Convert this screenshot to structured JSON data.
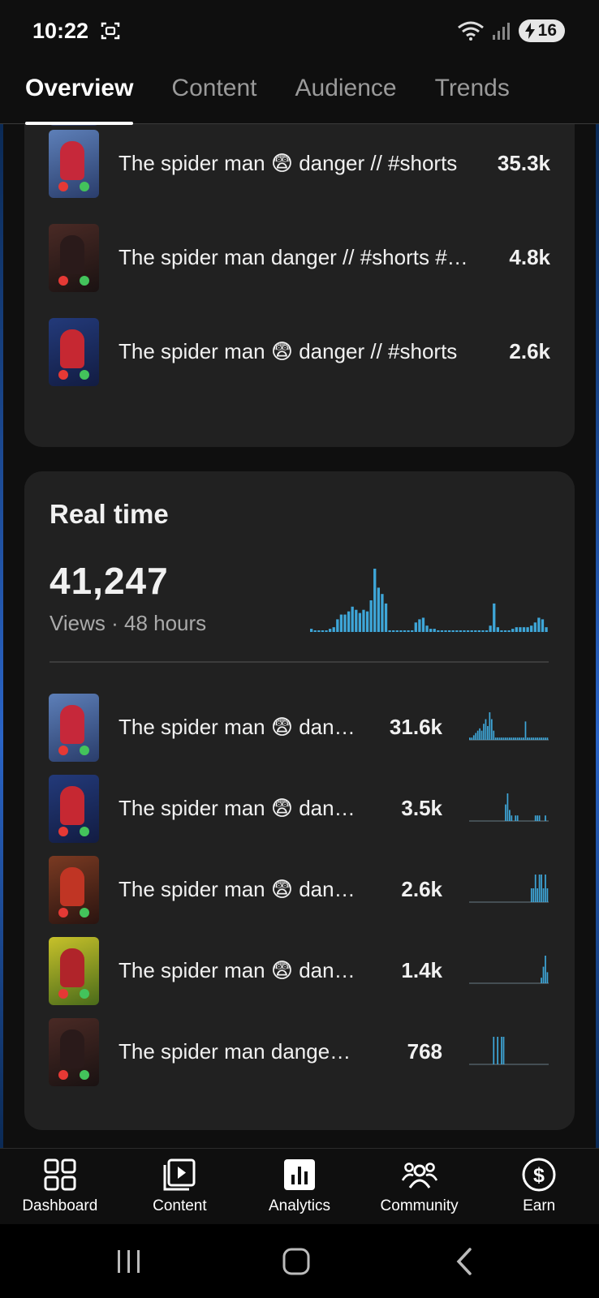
{
  "status_bar": {
    "time": "10:22",
    "battery": "16"
  },
  "tabs": [
    {
      "label": "Overview",
      "active": true
    },
    {
      "label": "Content",
      "active": false
    },
    {
      "label": "Audience",
      "active": false
    },
    {
      "label": "Trends",
      "active": false
    }
  ],
  "top_content_list": [
    {
      "title": "The spider man 😨 danger // #shorts",
      "value": "35.3k",
      "thumb": "blue"
    },
    {
      "title": "The spider man danger // #shorts #shorts",
      "value": "4.8k",
      "thumb": "dark"
    },
    {
      "title": "The spider man 😨 danger // #shorts",
      "value": "2.6k",
      "thumb": "navy"
    }
  ],
  "realtime": {
    "title": "Real time",
    "views": "41,247",
    "subtitle": "Views · 48 hours",
    "chart_data": {
      "type": "bar",
      "values": [
        2,
        1,
        1,
        1,
        1,
        2,
        3,
        8,
        11,
        11,
        13,
        16,
        14,
        12,
        14,
        13,
        20,
        40,
        28,
        24,
        18,
        1,
        1,
        1,
        1,
        1,
        1,
        1,
        6,
        8,
        9,
        4,
        2,
        2,
        1,
        1,
        1,
        1,
        1,
        1,
        1,
        1,
        1,
        1,
        1,
        1,
        1,
        1,
        4,
        18,
        3,
        1,
        1,
        1,
        2,
        3,
        3,
        3,
        3,
        4,
        6,
        9,
        8,
        3
      ]
    },
    "items": [
      {
        "title": "The spider man 😨 danger",
        "value": "31.6k",
        "thumb": "blue",
        "spark": [
          1,
          1,
          2,
          3,
          4,
          5,
          4,
          7,
          9,
          6,
          12,
          9,
          4,
          1,
          1,
          1,
          1,
          1,
          1,
          1,
          1,
          1,
          1,
          1,
          1,
          1,
          1,
          1,
          8,
          1,
          1,
          1,
          1,
          1,
          1,
          1,
          1,
          1,
          1,
          1
        ]
      },
      {
        "title": "The spider man 😨 danger",
        "value": "3.5k",
        "thumb": "navy",
        "spark": [
          0,
          0,
          0,
          0,
          0,
          0,
          0,
          0,
          0,
          0,
          0,
          0,
          0,
          0,
          0,
          0,
          0,
          0,
          3,
          5,
          2,
          1,
          0,
          1,
          1,
          0,
          0,
          0,
          0,
          0,
          0,
          0,
          0,
          1,
          1,
          1,
          0,
          0,
          1,
          0
        ]
      },
      {
        "title": "The spider man 😨 danger",
        "value": "2.6k",
        "thumb": "red",
        "spark": [
          0,
          0,
          0,
          0,
          0,
          0,
          0,
          0,
          0,
          0,
          0,
          0,
          0,
          0,
          0,
          0,
          0,
          0,
          0,
          0,
          0,
          0,
          0,
          0,
          0,
          0,
          0,
          0,
          0,
          0,
          0,
          1,
          1,
          2,
          1,
          2,
          2,
          1,
          2,
          1
        ]
      },
      {
        "title": "The spider man 😨 danger",
        "value": "1.4k",
        "thumb": "yellow",
        "spark": [
          0,
          0,
          0,
          0,
          0,
          0,
          0,
          0,
          0,
          0,
          0,
          0,
          0,
          0,
          0,
          0,
          0,
          0,
          0,
          0,
          0,
          0,
          0,
          0,
          0,
          0,
          0,
          0,
          0,
          0,
          0,
          0,
          0,
          0,
          0,
          0,
          1,
          3,
          5,
          2
        ]
      },
      {
        "title": "The spider man danger // #shorts",
        "value": "768",
        "thumb": "dark",
        "spark": [
          0,
          0,
          0,
          0,
          0,
          0,
          0,
          0,
          0,
          0,
          0,
          0,
          1,
          0,
          1,
          0,
          1,
          1,
          0,
          0,
          0,
          0,
          0,
          0,
          0,
          0,
          0,
          0,
          0,
          0,
          0,
          0,
          0,
          0,
          0,
          0,
          0,
          0,
          0,
          0
        ]
      }
    ]
  },
  "bottom_nav": [
    {
      "label": "Dashboard",
      "icon": "dashboard-icon"
    },
    {
      "label": "Content",
      "icon": "content-icon"
    },
    {
      "label": "Analytics",
      "icon": "analytics-icon"
    },
    {
      "label": "Community",
      "icon": "community-icon"
    },
    {
      "label": "Earn",
      "icon": "earn-icon"
    }
  ],
  "colors": {
    "chart_bar": "#3ea6d8",
    "card_bg": "#212121",
    "page_bg": "#0f0f0f"
  }
}
